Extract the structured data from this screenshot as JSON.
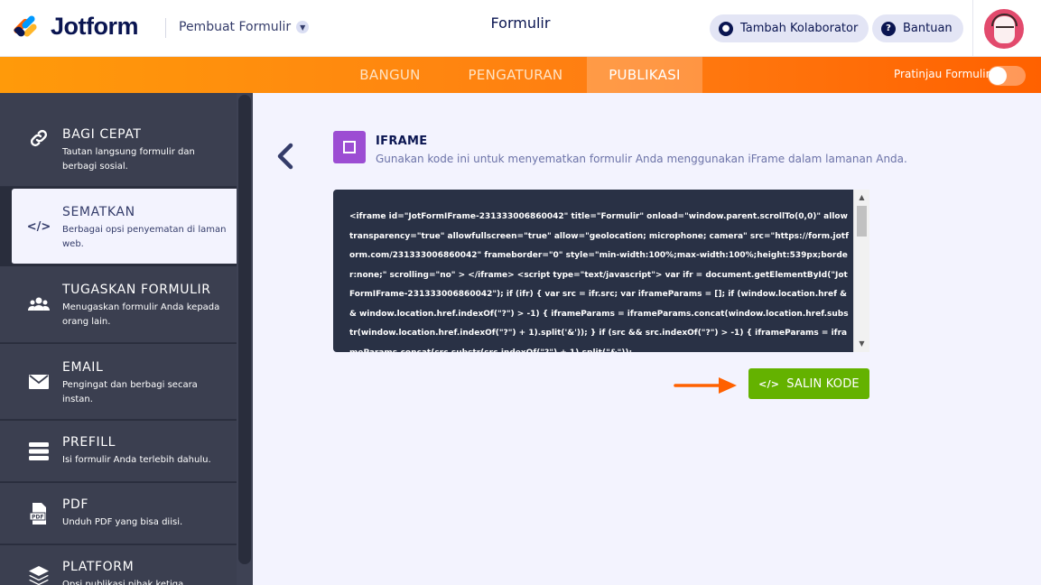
{
  "header": {
    "brand": "Jotform",
    "form_builder_label": "Pembuat Formulir",
    "page_title": "Formulir",
    "collaborator_label": "Tambah Kolaborator",
    "help_label": "Bantuan"
  },
  "nav": {
    "tabs": [
      {
        "label": "BANGUN"
      },
      {
        "label": "PENGATURAN"
      },
      {
        "label": "PUBLIKASI"
      }
    ],
    "active_tab": "PUBLIKASI",
    "preview_label": "Pratinjau Formulir",
    "preview_enabled": false
  },
  "sidebar": {
    "items": [
      {
        "title": "BAGI CEPAT",
        "desc": "Tautan langsung formulir dan berbagi sosial.",
        "icon": "link-icon"
      },
      {
        "title": "SEMATKAN",
        "desc": "Berbagai opsi penyematan di laman web.",
        "icon": "code-icon"
      },
      {
        "title": "TUGASKAN FORMULIR",
        "desc": "Menugaskan formulir Anda kepada orang lain.",
        "icon": "users-icon"
      },
      {
        "title": "EMAIL",
        "desc": "Pengingat dan berbagi secara instan.",
        "icon": "envelope-icon"
      },
      {
        "title": "PREFILL",
        "desc": "Isi formulir Anda terlebih dahulu.",
        "icon": "prefill-icon"
      },
      {
        "title": "PDF",
        "desc": "Unduh PDF yang bisa diisi.",
        "icon": "pdf-icon"
      },
      {
        "title": "PLATFORM",
        "desc": "Opsi publikasi pihak ketiga",
        "icon": "layers-icon"
      }
    ],
    "active_item": "SEMATKAN"
  },
  "main": {
    "section_title": "IFRAME",
    "section_desc": "Gunakan kode ini untuk menyematkan formulir Anda menggunakan iFrame dalam lamanan Anda.",
    "code": "<iframe id=\"JotFormIFrame-231333006860042\" title=\"Formulir\" onload=\"window.parent.scrollTo(0,0)\" allowtransparency=\"true\" allowfullscreen=\"true\" allow=\"geolocation; microphone; camera\" src=\"https://form.jotform.com/231333006860042\" frameborder=\"0\" style=\"min-width:100%;max-width:100%;height:539px;border:none;\" scrolling=\"no\" > </iframe> <script type=\"text/javascript\"> var ifr = document.getElementById(\"JotFormIFrame-231333006860042\"); if (ifr) { var src = ifr.src; var iframeParams = []; if (window.location.href && window.location.href.indexOf(\"?\") > -1) { iframeParams = iframeParams.concat(window.location.href.substr(window.location.href.indexOf(\"?\") + 1).split('&')); } if (src && src.indexOf(\"?\") > -1) { iframeParams = iframeParams.concat(src.substr(src.indexOf(\"?\") + 1).split(\"&\"));",
    "copy_button_label": "SALIN KODE",
    "copy_button_icon": "</>"
  },
  "colors": {
    "brand_orange": "#ff6100",
    "copy_green": "#64b200",
    "iframe_purple": "#9c4dd3",
    "code_bg": "#293145",
    "sidebar_bg": "#3b3f50"
  }
}
